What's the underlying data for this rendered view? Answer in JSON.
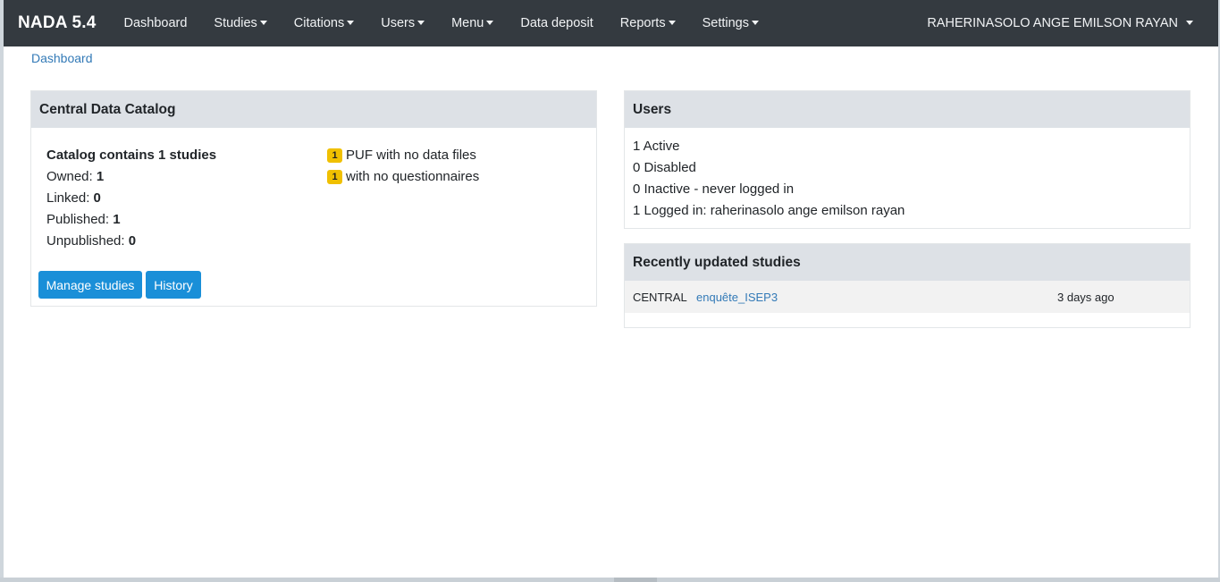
{
  "navbar": {
    "brand": "NADA 5.4",
    "items": [
      {
        "label": "Dashboard",
        "dropdown": false
      },
      {
        "label": "Studies",
        "dropdown": true
      },
      {
        "label": "Citations",
        "dropdown": true
      },
      {
        "label": "Users",
        "dropdown": true
      },
      {
        "label": "Menu",
        "dropdown": true
      },
      {
        "label": "Data deposit",
        "dropdown": false
      },
      {
        "label": "Reports",
        "dropdown": true
      },
      {
        "label": "Settings",
        "dropdown": true
      }
    ],
    "user": "RAHERINASOLO ANGE EMILSON RAYAN"
  },
  "breadcrumb": "Dashboard",
  "catalog": {
    "header": "Central Data Catalog",
    "summary": "Catalog contains 1 studies",
    "owned_label": "Owned: ",
    "owned_value": "1",
    "linked_label": "Linked: ",
    "linked_value": "0",
    "published_label": "Published: ",
    "published_value": "1",
    "unpublished_label": "Unpublished: ",
    "unpublished_value": "0",
    "alerts": [
      {
        "count": "1",
        "label": "PUF with no data files"
      },
      {
        "count": "1",
        "label": "with no questionnaires"
      }
    ],
    "manage_button": "Manage studies",
    "history_button": "History"
  },
  "users": {
    "header": "Users",
    "lines": [
      "1 Active",
      "0 Disabled",
      "0 Inactive - never logged in",
      "1 Logged in: raherinasolo ange emilson rayan"
    ]
  },
  "recent": {
    "header": "Recently updated studies",
    "rows": [
      {
        "repo": "CENTRAL",
        "title": "enquête_ISEP3",
        "time": "3 days ago"
      }
    ]
  },
  "colors": {
    "navbar_bg": "#343a40",
    "card_header_bg": "#dde1e6",
    "button_bg": "#1a8fd8",
    "link": "#337ab7",
    "badge": "#f0c000"
  }
}
